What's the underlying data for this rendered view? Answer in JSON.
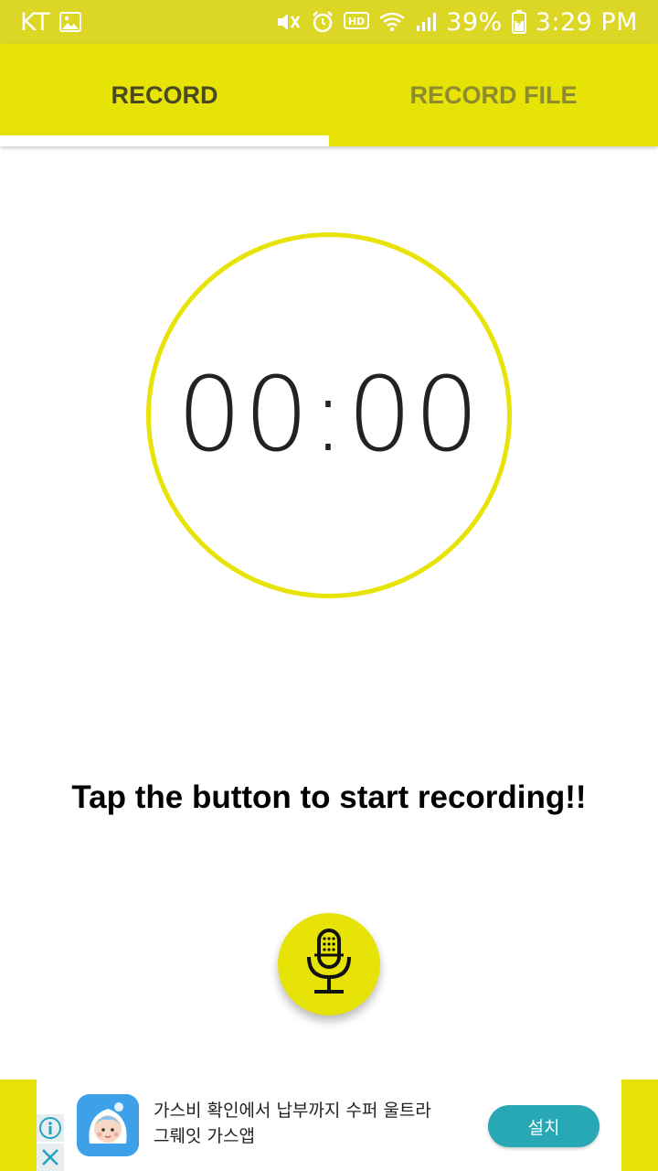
{
  "status_bar": {
    "carrier": "KT",
    "battery_percent": "39%",
    "time": "3:29 PM",
    "icons": [
      "image-icon",
      "mute-icon",
      "alarm-icon",
      "hd-icon",
      "wifi-icon",
      "signal-icon",
      "battery-icon"
    ]
  },
  "tabs": [
    {
      "label": "RECORD",
      "selected": true
    },
    {
      "label": "RECORD FILE",
      "selected": false
    }
  ],
  "timer": {
    "value": "00:00"
  },
  "hint": "Tap the button to start recording!!",
  "record_button": {
    "icon": "microphone-icon"
  },
  "ad": {
    "text_line1": "가스비 확인에서 납부까지 수퍼 울트라",
    "text_line2": "그뤠잇 가스앱",
    "install_label": "설치",
    "info_icon": "info-icon",
    "close_icon": "close-icon"
  },
  "colors": {
    "accent": "#e8e306",
    "status_bar": "#dcd725",
    "tab_selected_text": "#4a4a22",
    "tab_unselected_text": "#8d8b30",
    "ad_button": "#28a7b5"
  }
}
